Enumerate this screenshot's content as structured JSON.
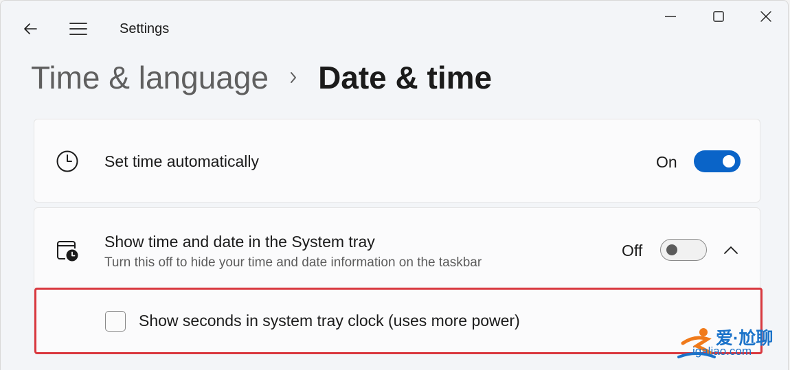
{
  "window": {
    "title": "Settings"
  },
  "breadcrumb": {
    "parent": "Time & language",
    "current": "Date & time"
  },
  "settings": {
    "set_time_automatically": {
      "title": "Set time automatically",
      "state_label": "On",
      "enabled": true
    },
    "show_time_in_tray": {
      "title": "Show time and date in the System tray",
      "description": "Turn this off to hide your time and date information on the taskbar",
      "state_label": "Off",
      "enabled": false,
      "expanded": true,
      "sub_option": {
        "label": "Show seconds in system tray clock (uses more power)",
        "checked": false
      }
    }
  },
  "icons": {
    "back": "arrow-left-icon",
    "menu": "hamburger-icon",
    "minimize": "minimize-icon",
    "maximize": "maximize-icon",
    "close": "close-icon",
    "clock": "clock-icon",
    "calendar_clock": "calendar-clock-icon",
    "chevron": "chevron-up-icon"
  },
  "colors": {
    "accent": "#0a64c8",
    "highlight": "#d9383f",
    "watermark": "#1a72c9"
  },
  "watermark": {
    "text": "爱·尬聊",
    "url": "igaliao.com"
  }
}
